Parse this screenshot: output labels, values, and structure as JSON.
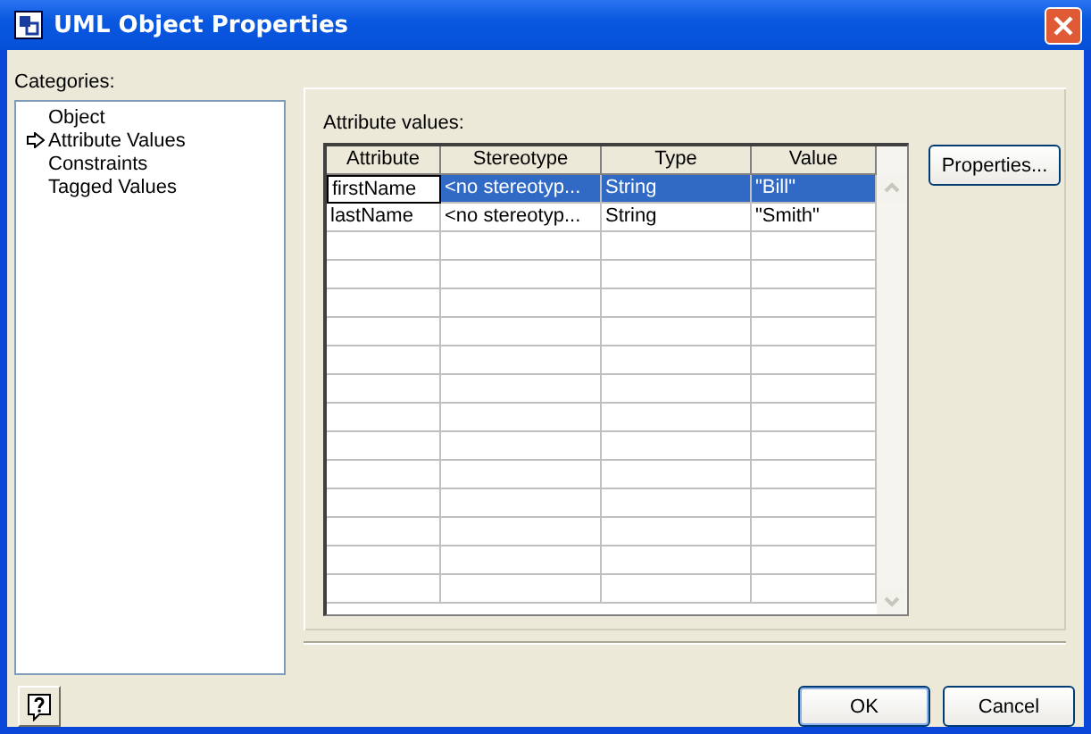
{
  "window": {
    "title": "UML Object Properties"
  },
  "categories": {
    "label": "Categories:",
    "items": [
      {
        "label": "Object",
        "selected": false
      },
      {
        "label": "Attribute Values",
        "selected": true
      },
      {
        "label": "Constraints",
        "selected": false
      },
      {
        "label": "Tagged Values",
        "selected": false
      }
    ]
  },
  "panel": {
    "label": "Attribute values:"
  },
  "table": {
    "columns": [
      "Attribute",
      "Stereotype",
      "Type",
      "Value"
    ],
    "rows": [
      {
        "cells": [
          "firstName",
          "<no stereotyp...",
          "String",
          "\"Bill\""
        ],
        "selected": true
      },
      {
        "cells": [
          "lastName",
          "<no stereotyp...",
          "String",
          "\"Smith\""
        ],
        "selected": false
      }
    ]
  },
  "side_buttons": [
    "Properties..."
  ],
  "buttons": [
    "OK",
    "Cancel"
  ]
}
